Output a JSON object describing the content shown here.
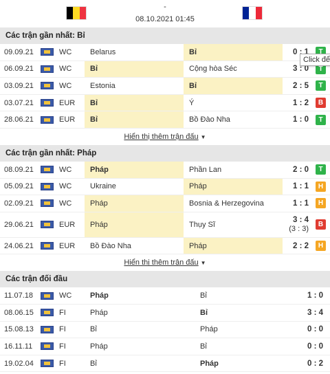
{
  "header": {
    "score": "-",
    "datetime": "08.10.2021 01:45",
    "home_flag_colors": [
      "#000000",
      "#fdda24",
      "#ef3340"
    ],
    "away_flag_colors": [
      "#002395",
      "#ffffff",
      "#ed2939"
    ]
  },
  "section1": {
    "title": "Các trận gần nhất: Bỉ",
    "more": "Hiển thị thêm trận đấu",
    "rows": [
      {
        "date": "09.09.21",
        "comp": "WC",
        "home": "Belarus",
        "away": "Bỉ",
        "score": "0 : 1",
        "res": "T"
      },
      {
        "date": "06.09.21",
        "comp": "WC",
        "home": "Bỉ",
        "away": "Cộng hòa Séc",
        "score": "3 : 0",
        "res": "T"
      },
      {
        "date": "03.09.21",
        "comp": "WC",
        "home": "Estonia",
        "away": "Bỉ",
        "score": "2 : 5",
        "res": "T"
      },
      {
        "date": "03.07.21",
        "comp": "EUR",
        "home": "Bỉ",
        "away": "Ý",
        "score": "1 : 2",
        "res": "B"
      },
      {
        "date": "28.06.21",
        "comp": "EUR",
        "home": "Bỉ",
        "away": "Bồ Đào Nha",
        "score": "1 : 0",
        "res": "T"
      }
    ]
  },
  "section2": {
    "title": "Các trận gần nhất: Pháp",
    "more": "Hiển thị thêm trận đấu",
    "rows": [
      {
        "date": "08.09.21",
        "comp": "WC",
        "home": "Pháp",
        "away": "Phần Lan",
        "score": "2 : 0",
        "res": "T"
      },
      {
        "date": "05.09.21",
        "comp": "WC",
        "home": "Ukraine",
        "away": "Pháp",
        "score": "1 : 1",
        "res": "H"
      },
      {
        "date": "02.09.21",
        "comp": "WC",
        "home": "Pháp",
        "away": "Bosnia & Herzegovina",
        "score": "1 : 1",
        "res": "H"
      },
      {
        "date": "29.06.21",
        "comp": "EUR",
        "home": "Pháp",
        "away": "Thụy Sĩ",
        "score": "3 : 4",
        "score_sub": "(3 : 3)",
        "res": "B"
      },
      {
        "date": "24.06.21",
        "comp": "EUR",
        "home": "Bồ Đào Nha",
        "away": "Pháp",
        "score": "2 : 2",
        "res": "H"
      }
    ]
  },
  "section3": {
    "title": "Các trận đối đầu",
    "rows": [
      {
        "date": "11.07.18",
        "comp": "WC",
        "home": "Pháp",
        "away": "Bỉ",
        "score": "1 : 0"
      },
      {
        "date": "08.06.15",
        "comp": "FI",
        "home": "Pháp",
        "away": "Bỉ",
        "score": "3 : 4"
      },
      {
        "date": "15.08.13",
        "comp": "FI",
        "home": "Bỉ",
        "away": "Pháp",
        "score": "0 : 0"
      },
      {
        "date": "16.11.11",
        "comp": "FI",
        "home": "Pháp",
        "away": "Bỉ",
        "score": "0 : 0"
      },
      {
        "date": "19.02.04",
        "comp": "FI",
        "home": "Bỉ",
        "away": "Pháp",
        "score": "0 : 2"
      }
    ]
  },
  "tooltip": "Click để c"
}
